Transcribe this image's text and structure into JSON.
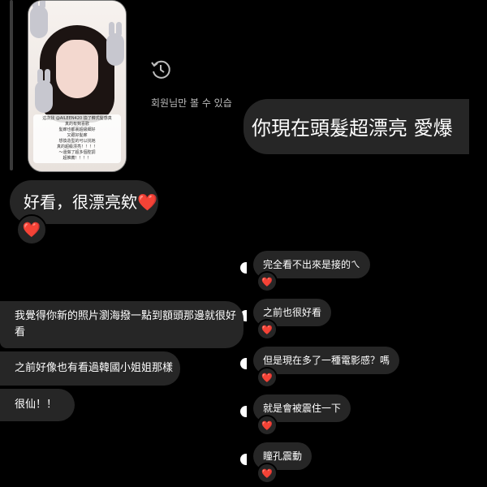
{
  "story": {
    "caption_lines": [
      "這次找 @AILEEN420 換了韓式髮感真",
      "真的有夠喜歡",
      "髮廊也都裏超級細好",
      "又跟好髮廊",
      "想換造型的可以找她",
      "真的超級漂亮！！！！",
      "～還做了超多個腔調",
      "超推薦！！！！"
    ]
  },
  "unsent_note": "회원님만 볼 수 있습",
  "messages": {
    "sent_big": "你現在頭髮超漂亮 愛爆",
    "received_big": "好看，很漂亮欸",
    "received_big_emoji": "❤️",
    "received_big_reaction": "❤️",
    "sent_1": "完全看不出來是接的ㄟ",
    "sent_2": "之前也很好看",
    "sent_3": "但是現在多了一種電影感？嗎",
    "sent_4": "就是會被震住一下",
    "sent_5": "瞳孔震動",
    "received_1": "我覺得你新的照片瀏海撥一點到額頭那邊就很好看",
    "received_2": "之前好像也有看過韓國小姐姐那樣",
    "received_3": "很仙！！"
  },
  "reaction": "❤️",
  "colors": {
    "background": "#000000",
    "bubble": "#262626",
    "text": "#ffffff",
    "heart": "#e11d2f",
    "secondary_text": "#bdbdbd"
  },
  "icons": [
    "revoke-icon",
    "heart-reaction-icon"
  ]
}
